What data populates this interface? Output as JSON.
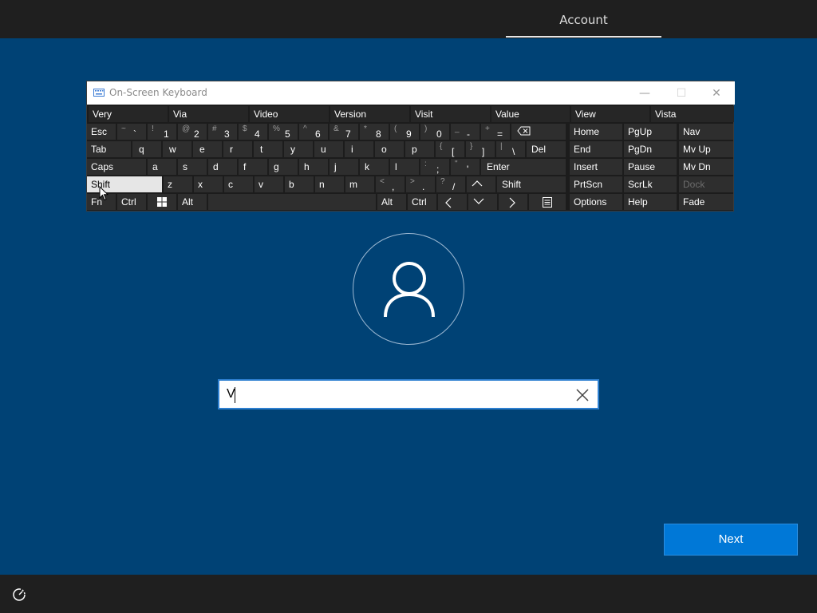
{
  "header": {
    "tab_label": "Account"
  },
  "osk": {
    "title": "On-Screen Keyboard",
    "minimize_glyph": "—",
    "maximize_glyph": "☐",
    "close_glyph": "✕",
    "predictions": [
      "Very",
      "Via",
      "Video",
      "Version",
      "Visit",
      "Value",
      "View",
      "Vista"
    ],
    "row1": {
      "esc": "Esc",
      "keys": [
        {
          "shift": "~",
          "main": "`"
        },
        {
          "shift": "!",
          "main": "1"
        },
        {
          "shift": "@",
          "main": "2"
        },
        {
          "shift": "#",
          "main": "3"
        },
        {
          "shift": "$",
          "main": "4"
        },
        {
          "shift": "%",
          "main": "5"
        },
        {
          "shift": "^",
          "main": "6"
        },
        {
          "shift": "&",
          "main": "7"
        },
        {
          "shift": "*",
          "main": "8"
        },
        {
          "shift": "(",
          "main": "9"
        },
        {
          "shift": ")",
          "main": "0"
        },
        {
          "shift": "_",
          "main": "-"
        },
        {
          "shift": "+",
          "main": "="
        }
      ]
    },
    "row2": {
      "tab": "Tab",
      "letters": [
        "q",
        "w",
        "e",
        "r",
        "t",
        "y",
        "u",
        "i",
        "o",
        "p"
      ],
      "brackets": [
        {
          "shift": "{",
          "main": "["
        },
        {
          "shift": "}",
          "main": "]"
        },
        {
          "shift": "|",
          "main": "\\"
        }
      ],
      "del": "Del"
    },
    "row3": {
      "caps": "Caps",
      "letters": [
        "a",
        "s",
        "d",
        "f",
        "g",
        "h",
        "j",
        "k",
        "l"
      ],
      "punct": [
        {
          "shift": ":",
          "main": ";"
        },
        {
          "shift": "\"",
          "main": "'"
        }
      ],
      "enter": "Enter"
    },
    "row4": {
      "shift_left": "Shift",
      "letters": [
        "z",
        "x",
        "c",
        "v",
        "b",
        "n",
        "m"
      ],
      "punct": [
        {
          "shift": "<",
          "main": ","
        },
        {
          "shift": ">",
          "main": "."
        },
        {
          "shift": "?",
          "main": "/"
        }
      ],
      "shift_right": "Shift"
    },
    "row5": {
      "fn": "Fn",
      "ctrl_left": "Ctrl",
      "alt_left": "Alt",
      "alt_right": "Alt",
      "ctrl_right": "Ctrl"
    },
    "nav": {
      "home": "Home",
      "pgup": "PgUp",
      "nav": "Nav",
      "end": "End",
      "pgdn": "PgDn",
      "mvup": "Mv Up",
      "insert": "Insert",
      "pause": "Pause",
      "mvdn": "Mv Dn",
      "prtscn": "PrtScn",
      "scrlk": "ScrLk",
      "dock": "Dock",
      "options": "Options",
      "help": "Help",
      "fade": "Fade"
    }
  },
  "login": {
    "username_value": "V",
    "next_label": "Next"
  },
  "colors": {
    "background": "#004275",
    "accent": "#0078d7",
    "bar": "#1f1f1f"
  }
}
